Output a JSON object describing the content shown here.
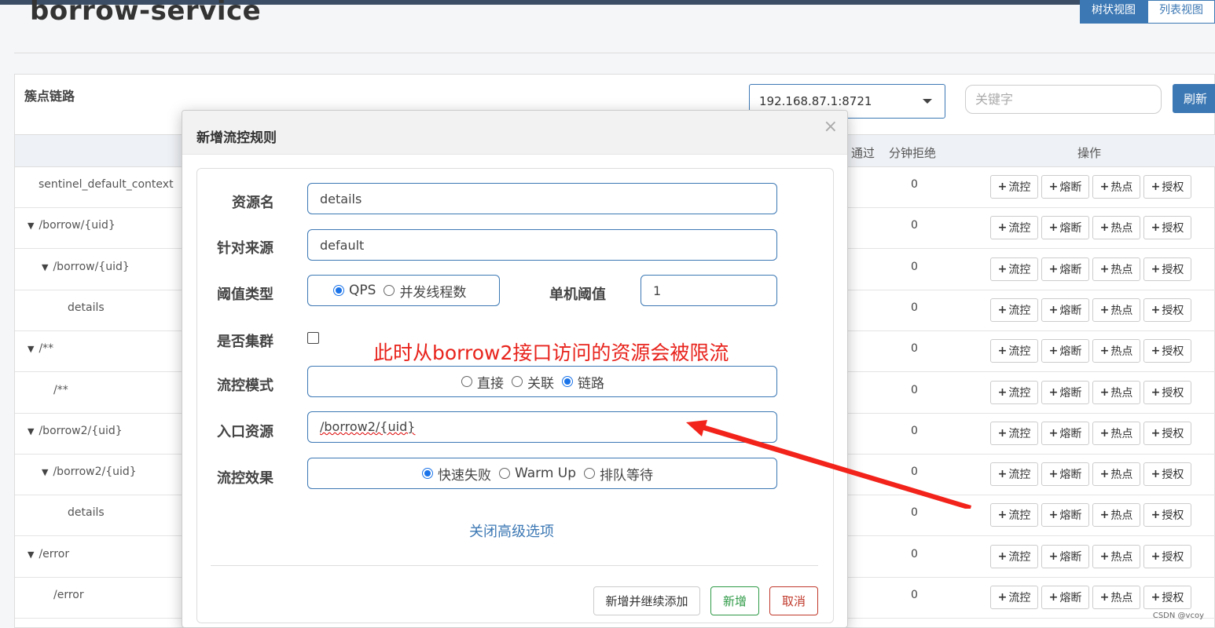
{
  "page": {
    "title": "borrow-service",
    "view_tabs": [
      "树状视图",
      "列表视图"
    ]
  },
  "panel": {
    "title": "簇点链路",
    "machine": "192.168.87.1:8721",
    "search_placeholder": "关键字",
    "refresh_label": "刷新",
    "columns": {
      "pass": "通过",
      "reject": "分钟拒绝",
      "ops": "操作"
    },
    "rows": [
      {
        "name": "sentinel_default_context",
        "indent": 0,
        "toggle": "",
        "reject": "0"
      },
      {
        "name": "/borrow/{uid}",
        "indent": 0,
        "toggle": "▼",
        "reject": "0"
      },
      {
        "name": "/borrow/{uid}",
        "indent": 1,
        "toggle": "▼",
        "reject": "0"
      },
      {
        "name": "details",
        "indent": 2,
        "toggle": "",
        "reject": "0"
      },
      {
        "name": "/**",
        "indent": 0,
        "toggle": "▼",
        "reject": "0"
      },
      {
        "name": "/**",
        "indent": 1,
        "toggle": "",
        "reject": "0"
      },
      {
        "name": "/borrow2/{uid}",
        "indent": 0,
        "toggle": "▼",
        "reject": "0"
      },
      {
        "name": "/borrow2/{uid}",
        "indent": 1,
        "toggle": "▼",
        "reject": "0"
      },
      {
        "name": "details",
        "indent": 2,
        "toggle": "",
        "reject": "0"
      },
      {
        "name": "/error",
        "indent": 0,
        "toggle": "▼",
        "reject": "0"
      },
      {
        "name": "/error",
        "indent": 1,
        "toggle": "",
        "reject": "0"
      }
    ],
    "actions": [
      "流控",
      "熔断",
      "热点",
      "授权"
    ]
  },
  "modal": {
    "title": "新增流控规则",
    "close": "×",
    "resource_label": "资源名",
    "resource_value": "details",
    "origin_label": "针对来源",
    "origin_value": "default",
    "threshold_type_label": "阈值类型",
    "threshold_types": [
      "QPS",
      "并发线程数"
    ],
    "threshold_type_selected": "QPS",
    "single_threshold_label": "单机阈值",
    "single_threshold_value": "1",
    "cluster_label": "是否集群",
    "cluster_checked": false,
    "mode_label": "流控模式",
    "modes": [
      "直接",
      "关联",
      "链路"
    ],
    "mode_selected": "链路",
    "entry_label": "入口资源",
    "entry_value": "/borrow2/{uid}",
    "effect_label": "流控效果",
    "effects": [
      "快速失败",
      "Warm Up",
      "排队等待"
    ],
    "effect_selected": "快速失败",
    "advanced_link": "关闭高级选项",
    "btn_add_continue": "新增并继续添加",
    "btn_add": "新增",
    "btn_cancel": "取消"
  },
  "annotation": {
    "text": "此时从borrow2接口访问的资源会被限流",
    "color": "#e8231c"
  },
  "watermark": "CSDN @vcoy",
  "colors": {
    "primary": "#3c78b4",
    "success": "#2e9a46",
    "danger": "#c0392b"
  }
}
